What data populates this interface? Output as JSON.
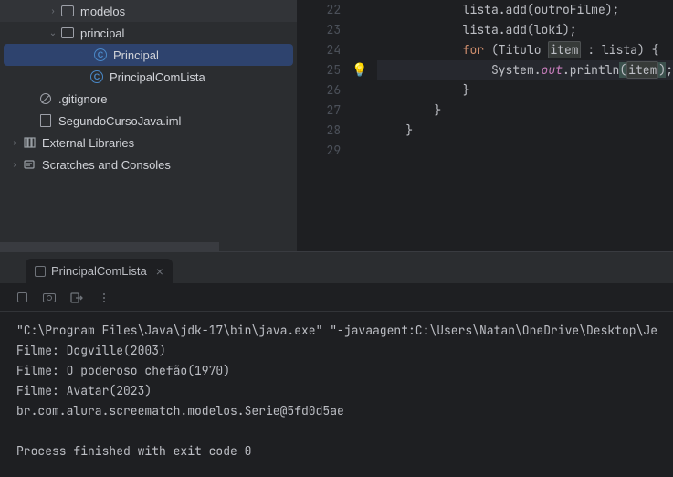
{
  "sidebar": {
    "items": [
      {
        "indent": 42,
        "chev": "›",
        "icon": "folder",
        "label": "modelos"
      },
      {
        "indent": 42,
        "chev": "⌄",
        "icon": "folder",
        "label": "principal"
      },
      {
        "indent": 74,
        "chev": "",
        "icon": "class",
        "label": "Principal",
        "selected": true
      },
      {
        "indent": 74,
        "chev": "",
        "icon": "class",
        "label": "PrincipalComLista"
      },
      {
        "indent": 18,
        "chev": "",
        "icon": "ignore",
        "label": ".gitignore"
      },
      {
        "indent": 18,
        "chev": "",
        "icon": "iml",
        "label": "SegundoCursoJava.iml"
      },
      {
        "indent": 0,
        "chev": "›",
        "icon": "lib",
        "label": "External Libraries"
      },
      {
        "indent": 0,
        "chev": "›",
        "icon": "scratch",
        "label": "Scratches and Consoles"
      }
    ]
  },
  "editor": {
    "lines": [
      {
        "n": 22,
        "pre": "            ",
        "plain": "lista.add(outroFilme);"
      },
      {
        "n": 23,
        "pre": "            ",
        "plain": "lista.add(loki);"
      },
      {
        "n": 24,
        "pre": "            ",
        "kw": "for",
        "mid1": " (Titulo ",
        "hl": "item",
        "mid2": " : lista) {"
      },
      {
        "n": 25,
        "pre": "                ",
        "sys": "System.",
        "out": "out",
        "call1": ".println",
        "lp": "(",
        "arg": "item",
        "rp": ")",
        "tail": ";",
        "bulb": true,
        "current": true
      },
      {
        "n": 26,
        "pre": "            ",
        "plain": "}"
      },
      {
        "n": 27,
        "pre": "        ",
        "plain": "}"
      },
      {
        "n": 28,
        "pre": "    ",
        "plain": "}"
      },
      {
        "n": 29,
        "pre": "",
        "plain": ""
      }
    ]
  },
  "run": {
    "tab_label": "PrincipalComLista",
    "output": "\"C:\\Program Files\\Java\\jdk-17\\bin\\java.exe\" \"-javaagent:C:\\Users\\Natan\\OneDrive\\Desktop\\Je\nFilme: Dogville(2003)\nFilme: O poderoso chefão(1970)\nFilme: Avatar(2023)\nbr.com.alura.screematch.modelos.Serie@5fd0d5ae\n\nProcess finished with exit code 0"
  }
}
